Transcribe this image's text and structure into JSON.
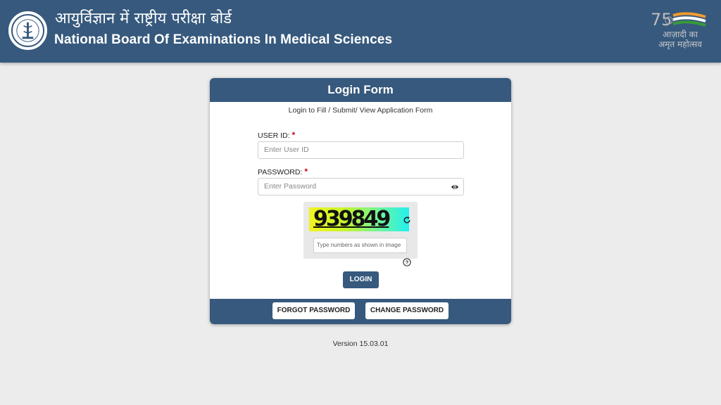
{
  "header": {
    "hindi_title": "आयुर्विज्ञान में राष्ट्रीय परीक्षा बोर्ड",
    "english_title": "National Board Of Examinations In Medical Sciences",
    "azadi_line1": "आज़ादी का",
    "azadi_line2": "अमृत महोत्सव",
    "azadi_number": "75"
  },
  "login_form": {
    "title": "Login Form",
    "subtitle": "Login to Fill / Submit/ View Application Form",
    "user_id_label": "USER ID:",
    "user_id_placeholder": "Enter User ID",
    "password_label": "PASSWORD:",
    "password_placeholder": "Enter Password",
    "required_mark": "*",
    "captcha_text": "939849",
    "captcha_placeholder": "Type numbers as shown in image",
    "login_button": "LOGIN",
    "forgot_password_button": "FORGOT PASSWORD",
    "change_password_button": "CHANGE PASSWORD"
  },
  "footer": {
    "version": "Version 15.03.01"
  },
  "colors": {
    "brand": "#36597d",
    "background": "#ececec",
    "required": "#d0021b"
  },
  "icons": [
    "nbe-logo-icon",
    "azadi-emblem-icon",
    "eye-icon",
    "refresh-icon",
    "help-icon"
  ]
}
